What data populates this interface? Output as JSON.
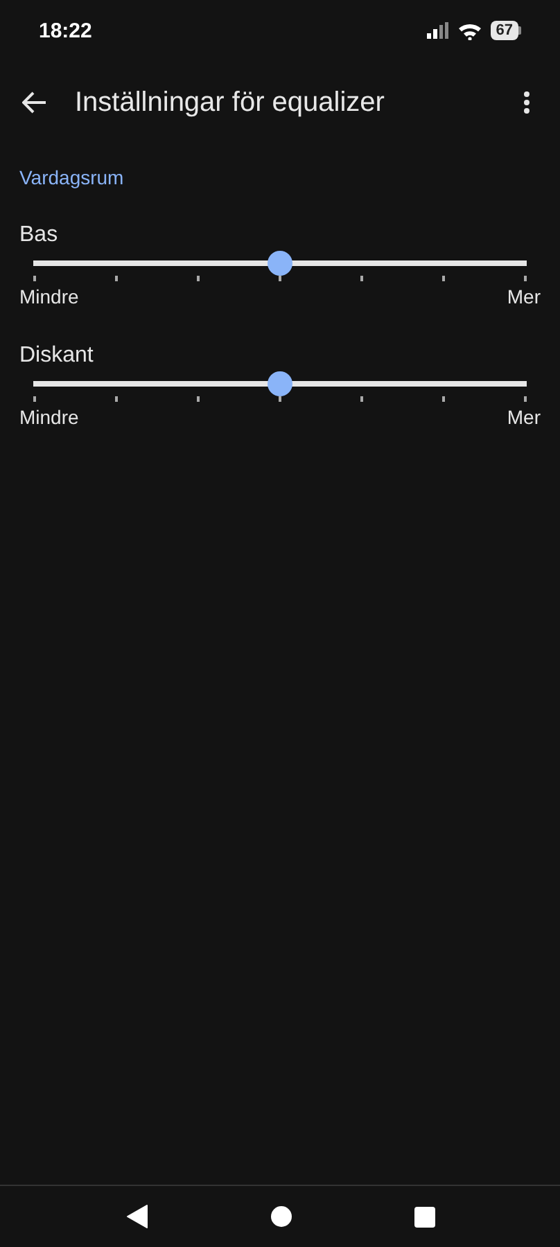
{
  "status_bar": {
    "time": "18:22",
    "battery": "67"
  },
  "app_bar": {
    "title": "Inställningar för equalizer"
  },
  "section": {
    "title": "Vardagsrum"
  },
  "sliders": [
    {
      "label": "Bas",
      "level": 0.5,
      "min_label": "Mindre",
      "max_label": "Mer"
    },
    {
      "label": "Diskant",
      "level": 0.5,
      "min_label": "Mindre",
      "max_label": "Mer"
    }
  ]
}
